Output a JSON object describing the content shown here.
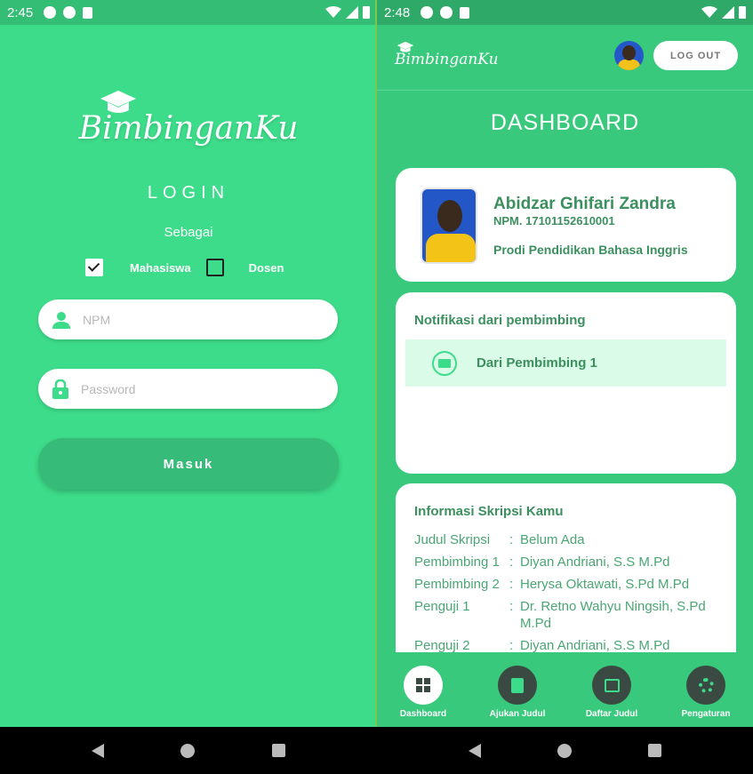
{
  "left": {
    "status": {
      "time": "2:45"
    },
    "logo": "BimbinganKu",
    "login_title": "LOGIN",
    "sebagai": "Sebagai",
    "roles": [
      {
        "label": "Mahasiswa",
        "checked": true
      },
      {
        "label": "Dosen",
        "checked": false
      }
    ],
    "npm": {
      "placeholder": "NPM",
      "value": ""
    },
    "password": {
      "placeholder": "Password",
      "value": ""
    },
    "submit_label": "Masuk"
  },
  "right": {
    "status": {
      "time": "2:48"
    },
    "logo": "BimbinganKu",
    "logout_label": "LOG OUT",
    "title": "DASHBOARD",
    "profile": {
      "name": "Abidzar Ghifari Zandra",
      "npm": "NPM. 17101152610001",
      "prodi": "Prodi Pendidikan Bahasa Inggris"
    },
    "notifications": {
      "heading": "Notifikasi dari pembimbing",
      "items": [
        {
          "label": "Dari Pembimbing 1"
        }
      ]
    },
    "info": {
      "heading": "Informasi Skripsi Kamu",
      "rows": [
        {
          "key": "Judul Skripsi",
          "value": "Belum Ada"
        },
        {
          "key": "Pembimbing 1",
          "value": "Diyan Andriani, S.S M.Pd"
        },
        {
          "key": "Pembimbing 2",
          "value": "Herysa Oktawati, S.Pd M.Pd"
        },
        {
          "key": "Penguji 1",
          "value": "Dr. Retno Wahyu Ningsih, S.Pd M.Pd"
        },
        {
          "key": "Penguji 2",
          "value": "Diyan Andriani, S.S M.Pd"
        }
      ]
    },
    "bottom_nav": [
      {
        "label": "Dashboard",
        "icon": "dashboard-icon",
        "active": true
      },
      {
        "label": "Ajukan Judul",
        "icon": "clipboard-icon",
        "active": false
      },
      {
        "label": "Daftar Judul",
        "icon": "list-doc-icon",
        "active": false
      },
      {
        "label": "Pengaturan",
        "icon": "gear-icon",
        "active": false
      }
    ]
  },
  "colors": {
    "primary": "#3ddc8a",
    "dark_green_text": "#3c8f5e",
    "notif_bg": "#d9fbe8"
  }
}
